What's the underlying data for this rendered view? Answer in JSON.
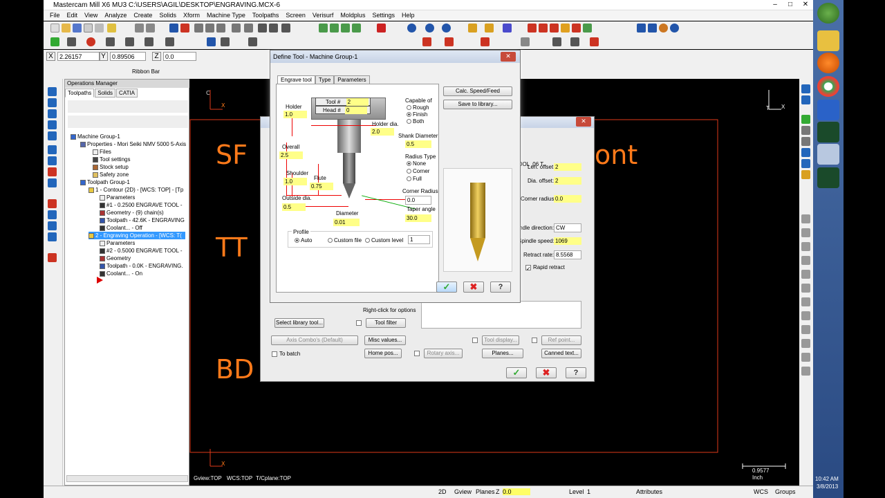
{
  "window": {
    "title": "Mastercam Mill X6 MU3  C:\\USERS\\AGIL\\DESKTOP\\ENGRAVING.MCX-6",
    "minimize": "–",
    "maximize": "□",
    "close": "✕"
  },
  "menu": [
    "File",
    "Edit",
    "View",
    "Analyze",
    "Create",
    "Solids",
    "Xform",
    "Machine Type",
    "Toolpaths",
    "Screen",
    "Verisurf",
    "Moldplus",
    "Settings",
    "Help"
  ],
  "ribbon": {
    "x_label": "X",
    "x_value": "2.26157",
    "y_label": "Y",
    "y_value": "0.89506",
    "z_label": "Z",
    "z_value": "0.0",
    "ribbon_bar_label": "Ribbon Bar"
  },
  "ops_manager": {
    "title": "Operations Manager",
    "tabs": [
      "Toolpaths",
      "Solids",
      "CATIA"
    ],
    "tree": [
      "Machine Group-1",
      "Properties - Mori Seiki NMV 5000 5-Axis",
      "Files",
      "Tool settings",
      "Stock setup",
      "Safety zone",
      "Toolpath Group-1",
      "1 - Contour (2D) - [WCS: TOP] - [Tp",
      "Parameters",
      "#1 - 0.2500 ENGRAVE TOOL -",
      "Geometry - (9) chain(s)",
      "Toolpath - 42.6K - ENGRAVING",
      "Coolant... - Off",
      "2 - Engraving Operation - [WCS: T(",
      "Parameters",
      "#2 - 0.5000 ENGRAVE TOOL -",
      "Geometry",
      "Toolpath - 0.0K - ENGRAVING.",
      "Coolant... - On"
    ]
  },
  "graphics": {
    "text1": "SF",
    "text2": "TT",
    "text3": "BD",
    "text4": "ont",
    "axis_x": "X",
    "axis_y": "Y",
    "axis_c": "C",
    "axis_t": "T",
    "scale_value": "0.9577",
    "scale_unit": "Inch",
    "gview": "Gview:TOP",
    "wcs": "WCS:TOP",
    "tcplane": "T/Cplane:TOP"
  },
  "back_dialog": {
    "tool_name": "EE ENGRAVE TOOL .06 T",
    "len_offset_label": "Len. offset:",
    "len_offset": "2",
    "dia_offset_label": "Dia. offset:",
    "dia_offset": "2",
    "corner_radius_label": "Corner radius:",
    "corner_radius": "0.0",
    "spindle_direction_label": "pindle direction:",
    "spindle_direction": "CW",
    "spindle_speed_label": "Spindle speed:",
    "spindle_speed": "1069",
    "retract_rate_label": "Retract rate:",
    "retract_rate": "8.5568",
    "rapid_retract_label": "Rapid retract",
    "right_click": "Right-click for options",
    "select_library_tool": "Select library tool...",
    "tool_filter": "Tool filter",
    "axis_combo": "Axis Combo's (Default)",
    "misc_values": "Misc values...",
    "tool_display": "Tool display...",
    "ref_point": "Ref point...",
    "to_batch": "To batch",
    "home_pos": "Home pos...",
    "rotary_axis": "Rotary axis...",
    "planes": "Planes...",
    "canned_text": "Canned text..."
  },
  "front_dialog": {
    "title": "Define Tool - Machine Group-1",
    "tabs": [
      "Engrave tool",
      "Type",
      "Parameters"
    ],
    "tool_num_label": "Tool #",
    "tool_num": "2",
    "head_num_label": "Head #",
    "head_num": "0",
    "holder_label": "Holder",
    "holder": "1.0",
    "holder_dia_label": "Holder dia.",
    "holder_dia": "2.0",
    "overall_label": "Overall",
    "overall": "2.5",
    "shoulder_label": "Shoulder",
    "shoulder": "1.0",
    "flute_label": "Flute",
    "flute": "0.75",
    "outside_dia_label": "Outside dia.",
    "outside_dia": "0.5",
    "diameter_label": "Diameter",
    "diameter": "0.01",
    "capable_label": "Capable of",
    "capable_options": [
      "Rough",
      "Finish",
      "Both"
    ],
    "shank_dia_label": "Shank Diameter",
    "shank_dia": "0.5",
    "radius_type_label": "Radius Type",
    "radius_options": [
      "None",
      "Corner",
      "Full"
    ],
    "corner_radius_label": "Corner Radius",
    "corner_radius": "0.0",
    "taper_angle_label": "Taper angle",
    "taper_angle": "30.0",
    "profile_label": "Profile",
    "profile_options": [
      "Auto",
      "Custom file",
      "Custom level"
    ],
    "custom_level": "1",
    "calc_speed": "Calc. Speed/Feed",
    "save_library": "Save to library..."
  },
  "statusbar": {
    "mode": "2D",
    "gview": "Gview",
    "planes": "Planes",
    "z_label": "Z",
    "z_value": "0.0",
    "level_label": "Level",
    "level": "1",
    "attributes": "Attributes",
    "wcs": "WCS",
    "groups": "Groups"
  },
  "clock": {
    "time": "10:42 AM",
    "date": "3/8/2013"
  }
}
